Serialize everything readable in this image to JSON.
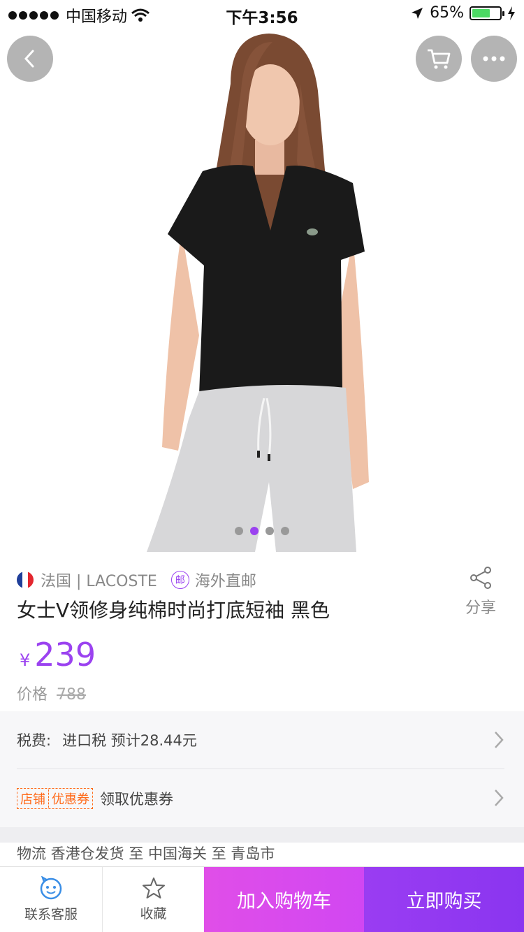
{
  "status_bar": {
    "carrier": "中国移动",
    "time": "下午3:56",
    "battery": "65%",
    "battery_level": 0.65
  },
  "nav": {
    "back_icon": "chevron-left-icon",
    "cart_icon": "cart-icon",
    "more_icon": "more-dots-icon"
  },
  "gallery": {
    "image_count": 4,
    "active_index": 1
  },
  "product": {
    "origin": "法国 | LACOSTE",
    "mail_badge": "邮",
    "shipping_label": "海外直邮",
    "title": "女士V领修身纯棉时尚打底短袖 黑色",
    "share_label": "分享",
    "currency": "¥",
    "price": "239",
    "original_price_label": "价格",
    "original_price": "788"
  },
  "rows": {
    "tax_label": "税费:",
    "tax_value": "进口税 预计28.44元",
    "coupon_tag_a": "店铺",
    "coupon_tag_b": "优惠券",
    "coupon_text": "领取优惠券"
  },
  "logistics": {
    "text": "物流 香港仓发货 至 中国海关 至 青岛市"
  },
  "bottom_bar": {
    "service_label": "联系客服",
    "favorite_label": "收藏",
    "add_to_cart": "加入购物车",
    "buy_now": "立即购买"
  },
  "colors": {
    "accent": "#9b42f0",
    "cart_button": "#d94bec",
    "buy_button": "#9038f0",
    "coupon": "#ff6a1a"
  }
}
